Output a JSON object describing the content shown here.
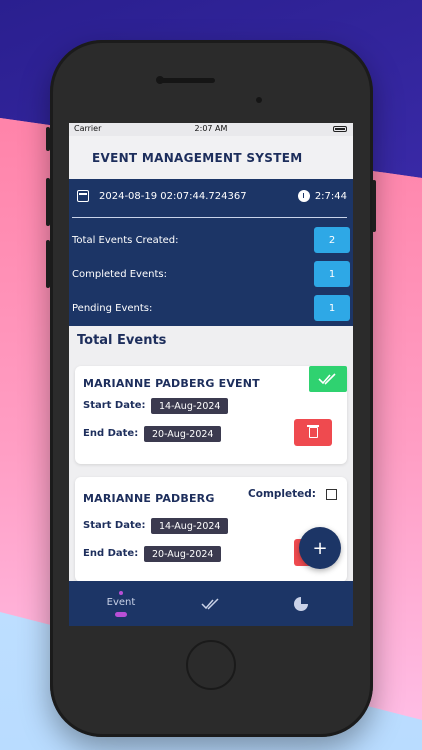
{
  "status_bar": {
    "carrier": "Carrier",
    "time": "2:07 AM"
  },
  "app": {
    "title": "EVENT MANAGEMENT SYSTEM"
  },
  "summary": {
    "datetime": "2024-08-19 02:07:44.724367",
    "timer": "2:7:44",
    "stats": [
      {
        "label": "Total Events Created:",
        "value": "2"
      },
      {
        "label": "Completed Events:",
        "value": "1"
      },
      {
        "label": "Pending Events:",
        "value": "1"
      }
    ]
  },
  "list": {
    "title": "Total Events",
    "events": [
      {
        "name": "MARIANNE PADBERG EVENT",
        "start_label": "Start Date:",
        "start": "14-Aug-2024",
        "end_label": "End Date:",
        "end": "20-Aug-2024",
        "completed": true
      },
      {
        "name": "MARIANNE PADBERG",
        "completed_label": "Completed:",
        "start_label": "Start Date:",
        "start": "14-Aug-2024",
        "end_label": "End Date:",
        "end": "20-Aug-2024",
        "completed": false
      }
    ]
  },
  "fab": {
    "icon": "plus-icon",
    "label": "+"
  },
  "tabs": [
    {
      "label": "Event",
      "icon": "event-icon",
      "active": true
    },
    {
      "label": "",
      "icon": "double-check-icon",
      "active": false
    },
    {
      "label": "",
      "icon": "pie-chart-icon",
      "active": false
    }
  ],
  "colors": {
    "primary": "#1c3566",
    "badge": "#2ea8e6",
    "success": "#2fd270",
    "danger": "#ef4a4f",
    "accent": "#b84fd6"
  }
}
